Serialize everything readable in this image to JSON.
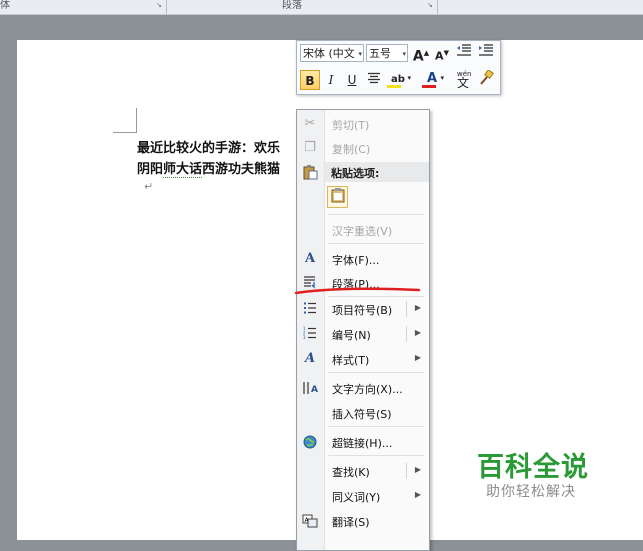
{
  "ribbon": {
    "group_font_label": "体",
    "group_paragraph_label": "段落",
    "launcher_glyph": "↘"
  },
  "document": {
    "line1": "最近比较火的手游：欢乐",
    "line2_part1": "阴阳",
    "line2_squiggle": "师大话",
    "line2_part2": "西游功夫熊猫",
    "paragraph_mark": "↵"
  },
  "mini_toolbar": {
    "font_name": "宋体 (中文",
    "font_size": "五号",
    "grow_font": "A",
    "shrink_font": "A",
    "bold": "B",
    "italic": "I",
    "underline": "U",
    "highlight": "ab",
    "font_color": "A",
    "phonetic": "wén",
    "phonetic_char": "文",
    "dropdown_arrow": "▾"
  },
  "context_menu": {
    "cut": "剪切(T)",
    "copy": "复制(C)",
    "paste_options": "粘贴选项:",
    "hanzi_reselect": "汉字重选(V)",
    "font": "字体(F)...",
    "paragraph": "段落(P)...",
    "bullets": "项目符号(B)",
    "numbering": "编号(N)",
    "styles": "样式(T)",
    "text_direction": "文字方向(X)...",
    "insert_symbol": "插入符号(S)",
    "hyperlink": "超链接(H)...",
    "find": "查找(K)",
    "synonyms": "同义词(Y)",
    "translate": "翻译(S)",
    "submenu_arrow": "▶"
  },
  "watermark": {
    "title": "百科全说",
    "subtitle": "助你轻松解决"
  },
  "colors": {
    "annotation_red": "#e02020",
    "watermark_green": "#2a9a36"
  }
}
